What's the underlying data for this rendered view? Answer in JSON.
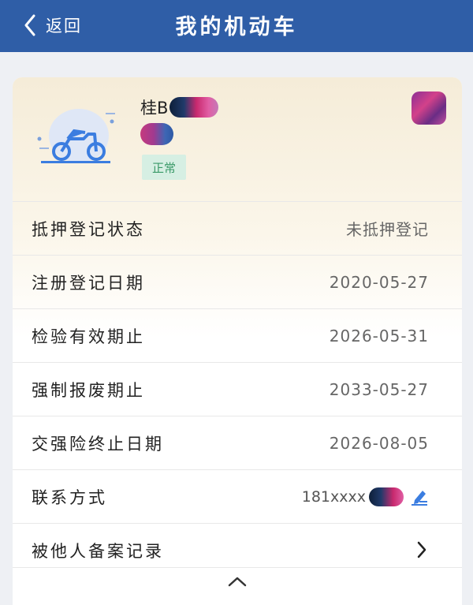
{
  "header": {
    "back_label": "返回",
    "title": "我的机动车"
  },
  "vehicle": {
    "plate_prefix": "桂B",
    "status_badge": "正常",
    "icon": "motorcycle-icon"
  },
  "rows": [
    {
      "label": "抵押登记状态",
      "value": "未抵押登记"
    },
    {
      "label": "注册登记日期",
      "value": "2020-05-27"
    },
    {
      "label": "检验有效期止",
      "value": "2026-05-31"
    },
    {
      "label": "强制报废期止",
      "value": "2033-05-27"
    },
    {
      "label": "交强险终止日期",
      "value": "2026-08-05"
    },
    {
      "label": "联系方式",
      "value": "181xxxx"
    },
    {
      "label": "被他人备案记录",
      "value": ""
    }
  ],
  "colors": {
    "header_bg": "#2f5ea7",
    "badge_bg": "#d6efe3",
    "badge_text": "#3a9a68",
    "accent": "#3b7de0"
  }
}
